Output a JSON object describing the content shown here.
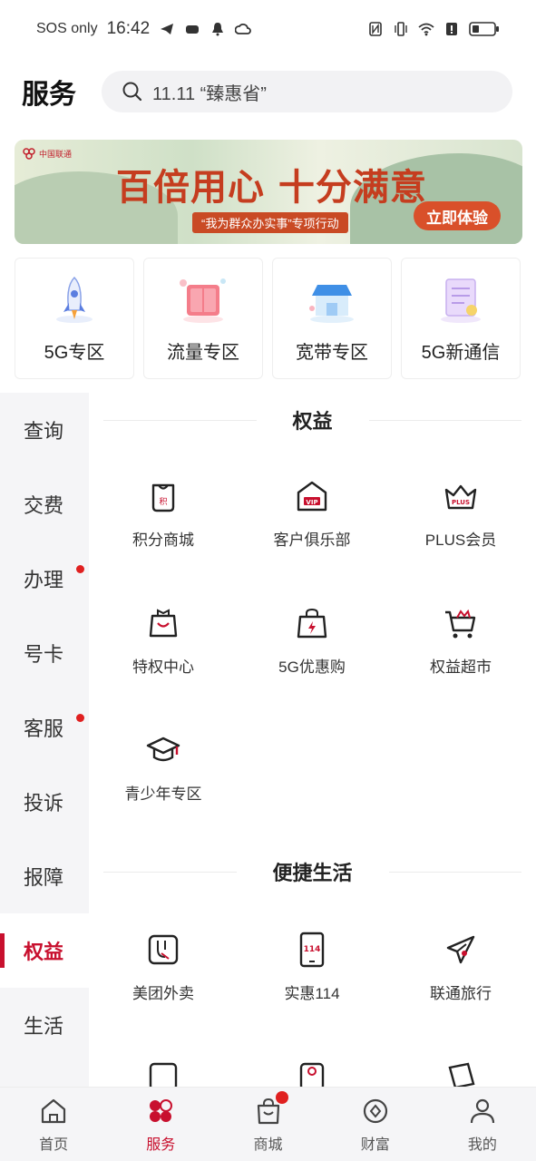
{
  "status_bar": {
    "carrier": "SOS only",
    "time": "16:42",
    "icons": [
      "telegram-icon",
      "game-icon",
      "bell-icon",
      "cloud-icon",
      "nfc-icon",
      "vibrate-icon",
      "wifi-icon",
      "alert-icon",
      "battery-icon"
    ]
  },
  "header": {
    "title": "服务",
    "search_placeholder": "11.11 “臻惠省”"
  },
  "banner": {
    "brand": "中国联通",
    "headline": "百倍用心 十分满意",
    "subtitle": "“我为群众办实事”专项行动",
    "cta": "立即体验"
  },
  "zones": [
    {
      "label": "5G专区",
      "icon": "rocket-icon"
    },
    {
      "label": "流量专区",
      "icon": "traffic-icon"
    },
    {
      "label": "宽带专区",
      "icon": "store-icon"
    },
    {
      "label": "5G新通信",
      "icon": "document-icon"
    }
  ],
  "sidebar": {
    "items": [
      {
        "label": "查询",
        "dot": false
      },
      {
        "label": "交费",
        "dot": false
      },
      {
        "label": "办理",
        "dot": true
      },
      {
        "label": "号卡",
        "dot": false
      },
      {
        "label": "客服",
        "dot": true
      },
      {
        "label": "投诉",
        "dot": false
      },
      {
        "label": "报障",
        "dot": false
      },
      {
        "label": "权益",
        "dot": false,
        "active": true
      },
      {
        "label": "生活",
        "dot": false
      }
    ]
  },
  "sections": [
    {
      "title": "权益",
      "items": [
        {
          "label": "积分商城",
          "icon": "points-bag-icon"
        },
        {
          "label": "客户俱乐部",
          "icon": "vip-house-icon"
        },
        {
          "label": "PLUS会员",
          "icon": "plus-crown-icon"
        },
        {
          "label": "特权中心",
          "icon": "privilege-bag-icon"
        },
        {
          "label": "5G优惠购",
          "icon": "shopping-bag-icon"
        },
        {
          "label": "权益超市",
          "icon": "cart-icon"
        },
        {
          "label": "青少年专区",
          "icon": "graduation-cap-icon"
        }
      ]
    },
    {
      "title": "便捷生活",
      "items": [
        {
          "label": "美团外卖",
          "icon": "kangaroo-icon"
        },
        {
          "label": "实惠114",
          "icon": "phone-114-icon"
        },
        {
          "label": "联通旅行",
          "icon": "airplane-icon"
        }
      ]
    }
  ],
  "tabbar": {
    "items": [
      {
        "label": "首页",
        "icon": "home-icon"
      },
      {
        "label": "服务",
        "icon": "service-icon",
        "active": true,
        "badge": true
      },
      {
        "label": "商城",
        "icon": "mall-bag-icon"
      },
      {
        "label": "财富",
        "icon": "wealth-icon"
      },
      {
        "label": "我的",
        "icon": "profile-icon"
      }
    ]
  },
  "colors": {
    "accent": "#c8102e",
    "badge": "#e02020"
  }
}
